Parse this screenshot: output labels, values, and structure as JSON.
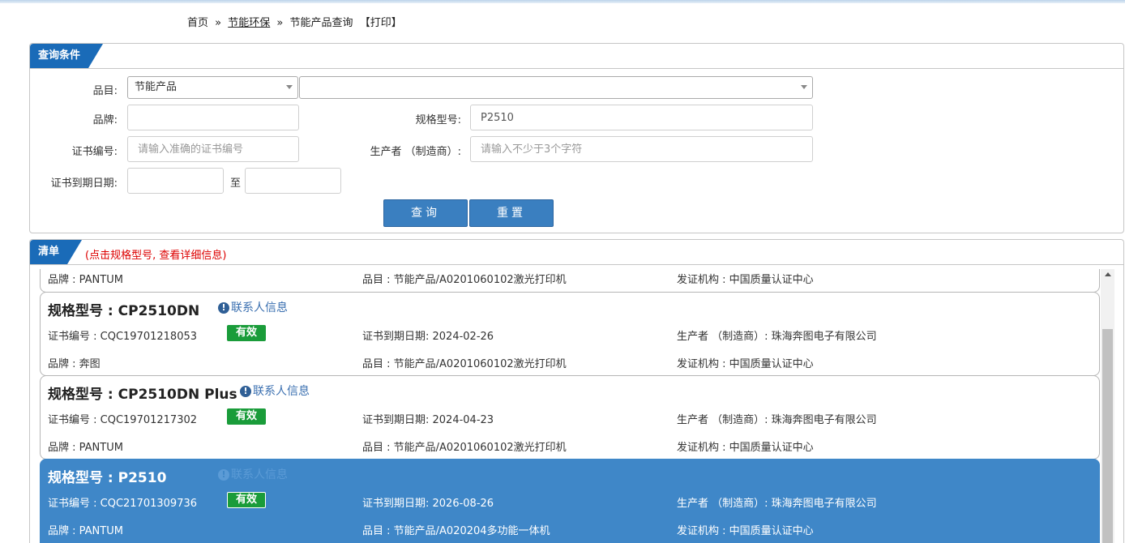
{
  "breadcrumb": {
    "home": "首页",
    "sep": "»",
    "section": "节能环保",
    "current": "节能产品查询",
    "print": "【打印】"
  },
  "query": {
    "tab": "查询条件",
    "category_label": "品目:",
    "category_value": "节能产品",
    "subcategory_value": "",
    "brand_label": "品牌:",
    "brand_value": "",
    "model_label": "规格型号:",
    "model_value": "P2510",
    "cert_label": "证书编号:",
    "cert_placeholder": "请输入准确的证书编号",
    "maker_label": "生产者 （制造商）:",
    "maker_placeholder": "请输入不少于3个字符",
    "expiry_label": "证书到期日期:",
    "to_label": "至",
    "search_button": "查询",
    "reset_button": "重置"
  },
  "list": {
    "tab": "清单",
    "hint": "(点击规格型号, 查看详细信息)",
    "contact_label": "联系人信息",
    "partial_first": {
      "brand": "品牌 : PANTUM",
      "category": "品目 : 节能产品/A0201060102激光打印机",
      "issuer": "发证机构 : 中国质量认证中心"
    },
    "items": [
      {
        "title": "规格型号 : CP2510DN",
        "cert": "证书编号 : CQC19701218053",
        "status": "有效",
        "expiry": "证书到期日期: 2024-02-26",
        "maker": "生产者 （制造商）: 珠海奔图电子有限公司",
        "brand": "品牌 : 奔图",
        "category": "品目 : 节能产品/A0201060102激光打印机",
        "issuer": "发证机构 : 中国质量认证中心"
      },
      {
        "title": "规格型号 : CP2510DN Plus",
        "cert": "证书编号 : CQC19701217302",
        "status": "有效",
        "expiry": "证书到期日期: 2024-04-23",
        "maker": "生产者 （制造商）: 珠海奔图电子有限公司",
        "brand": "品牌 : PANTUM",
        "category": "品目 : 节能产品/A0201060102激光打印机",
        "issuer": "发证机构 : 中国质量认证中心"
      },
      {
        "title": "规格型号 : P2510",
        "cert": "证书编号 : CQC21701309736",
        "status": "有效",
        "expiry": "证书到期日期: 2026-08-26",
        "maker": "生产者 （制造商）: 珠海奔图电子有限公司",
        "brand": "品牌 : PANTUM",
        "category": "品目 : 节能产品/A020204多功能一体机",
        "issuer": "发证机构 : 中国质量认证中心"
      }
    ]
  },
  "colors": {
    "accent": "#1a6bb8",
    "button": "#3a7fc0",
    "valid_badge": "#1a9c3a",
    "selected_row": "#3f87c8",
    "hint": "#dd0000"
  }
}
